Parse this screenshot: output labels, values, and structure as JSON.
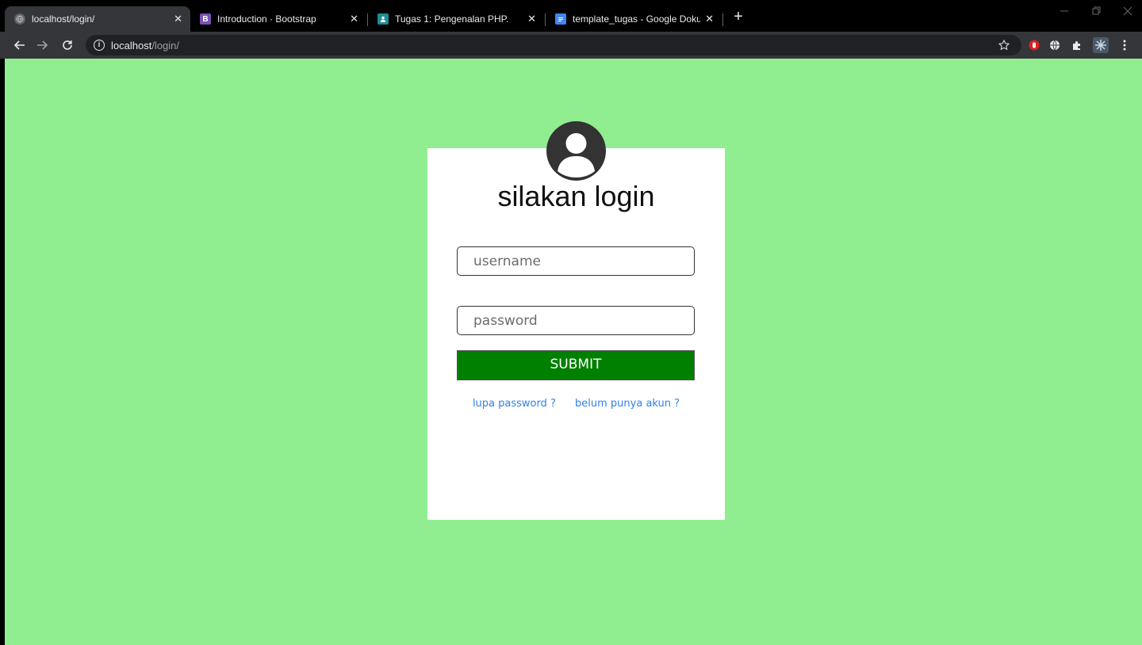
{
  "browser": {
    "tabs": [
      {
        "title": "localhost/login/",
        "active": true
      },
      {
        "title": "Introduction · Bootstrap",
        "favicon_letter": "B",
        "favicon_color": "#7952b3"
      },
      {
        "title": "Tugas 1: Pengenalan PHP.",
        "favicon_color": "#1e8e96"
      },
      {
        "title": "template_tugas - Google Dokum",
        "favicon_color": "#4285f4"
      }
    ],
    "tab_close_glyph": "✕",
    "new_tab_glyph": "+",
    "address": {
      "host": "localhost",
      "path": "/login/"
    }
  },
  "login": {
    "title": "silakan login",
    "username_placeholder": "username",
    "password_placeholder": "password",
    "submit_label": "SUBMIT",
    "forgot_link": "lupa password ?",
    "register_link": "belum punya akun ?"
  },
  "colors": {
    "page_background": "#90ee90",
    "submit_background": "#008000",
    "link": "#2f80ed"
  }
}
